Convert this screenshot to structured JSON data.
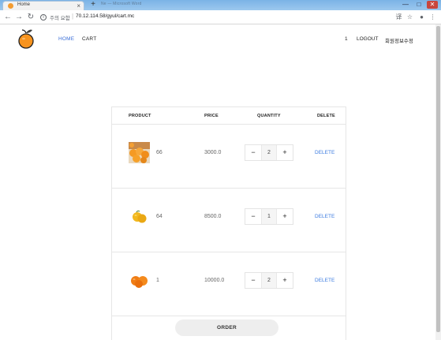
{
  "browser": {
    "tab_title": "Home",
    "tab_close": "×",
    "new_tab": "+",
    "ghost_tab_text": "Ne — Microsoft Word",
    "window_buttons": {
      "minimize": "—",
      "maximize": "□",
      "close": "✕"
    },
    "nav": {
      "back": "←",
      "forward": "→",
      "reload": "↻"
    },
    "security_text": "주의 요함",
    "url_separator": "|",
    "url": "70.12.114.58/gyul/cart.mc",
    "info_glyph": "i",
    "toolbar_icons": {
      "translate": "译",
      "star": "☆",
      "account": "●",
      "menu": "⋮"
    }
  },
  "site": {
    "nav": {
      "home": "HOME",
      "cart": "CART"
    },
    "user_count": "1",
    "logout": "LOGOUT",
    "profile_edit": "회원정보수정",
    "accent_color": "#3b6fd8"
  },
  "cart": {
    "headers": {
      "product": "PRODUCT",
      "price": "PRICE",
      "quantity": "QUANTITY",
      "delete": "DELETE"
    },
    "items": [
      {
        "name": "66",
        "price": "3000.0",
        "qty": "2",
        "minus": "−",
        "plus": "+",
        "delete": "DELETE"
      },
      {
        "name": "64",
        "price": "8500.0",
        "qty": "1",
        "minus": "−",
        "plus": "+",
        "delete": "DELETE"
      },
      {
        "name": "1",
        "price": "10000.0",
        "qty": "2",
        "minus": "−",
        "plus": "+",
        "delete": "DELETE"
      }
    ],
    "order_label": "ORDER"
  }
}
